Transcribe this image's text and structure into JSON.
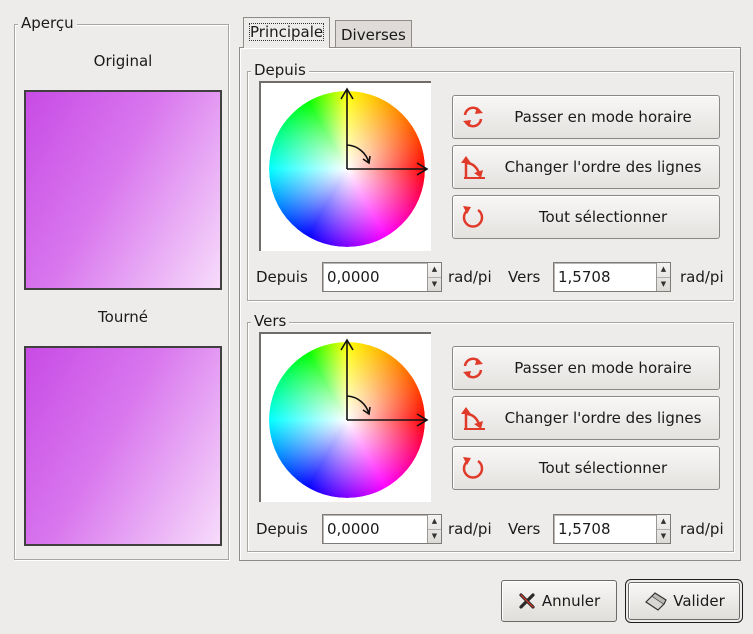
{
  "preview": {
    "frame_label": "Aperçu",
    "original_label": "Original",
    "rotated_label": "Tourné"
  },
  "tabs": [
    {
      "label": "Principale",
      "active": true
    },
    {
      "label": "Diverses",
      "active": false
    }
  ],
  "ranges": [
    {
      "frame_label": "Depuis",
      "buttons": {
        "clockwise": {
          "label": "Passer en mode horaire",
          "icon": "rotate-arrows-icon"
        },
        "swap_order": {
          "label": "Changer l'ordre des lignes",
          "icon": "swap-order-icon"
        },
        "select_all": {
          "label": "Tout sélectionner",
          "icon": "circle-arrow-icon"
        }
      },
      "from_label": "Depuis",
      "from_value": "0,0000",
      "from_unit": "rad/pi",
      "to_label": "Vers",
      "to_value": "1,5708",
      "to_unit": "rad/pi"
    },
    {
      "frame_label": "Vers",
      "buttons": {
        "clockwise": {
          "label": "Passer en mode horaire",
          "icon": "rotate-arrows-icon"
        },
        "swap_order": {
          "label": "Changer l'ordre des lignes",
          "icon": "swap-order-icon"
        },
        "select_all": {
          "label": "Tout sélectionner",
          "icon": "circle-arrow-icon"
        }
      },
      "from_label": "Depuis",
      "from_value": "0,0000",
      "from_unit": "rad/pi",
      "to_label": "Vers",
      "to_value": "1,5708",
      "to_unit": "rad/pi"
    }
  ],
  "dialog": {
    "cancel_label": "Annuler",
    "ok_label": "Valider"
  },
  "colors": {
    "preview_start": "#c84be5",
    "preview_end": "#f7dcfb",
    "icon_red": "#e03a2a"
  }
}
